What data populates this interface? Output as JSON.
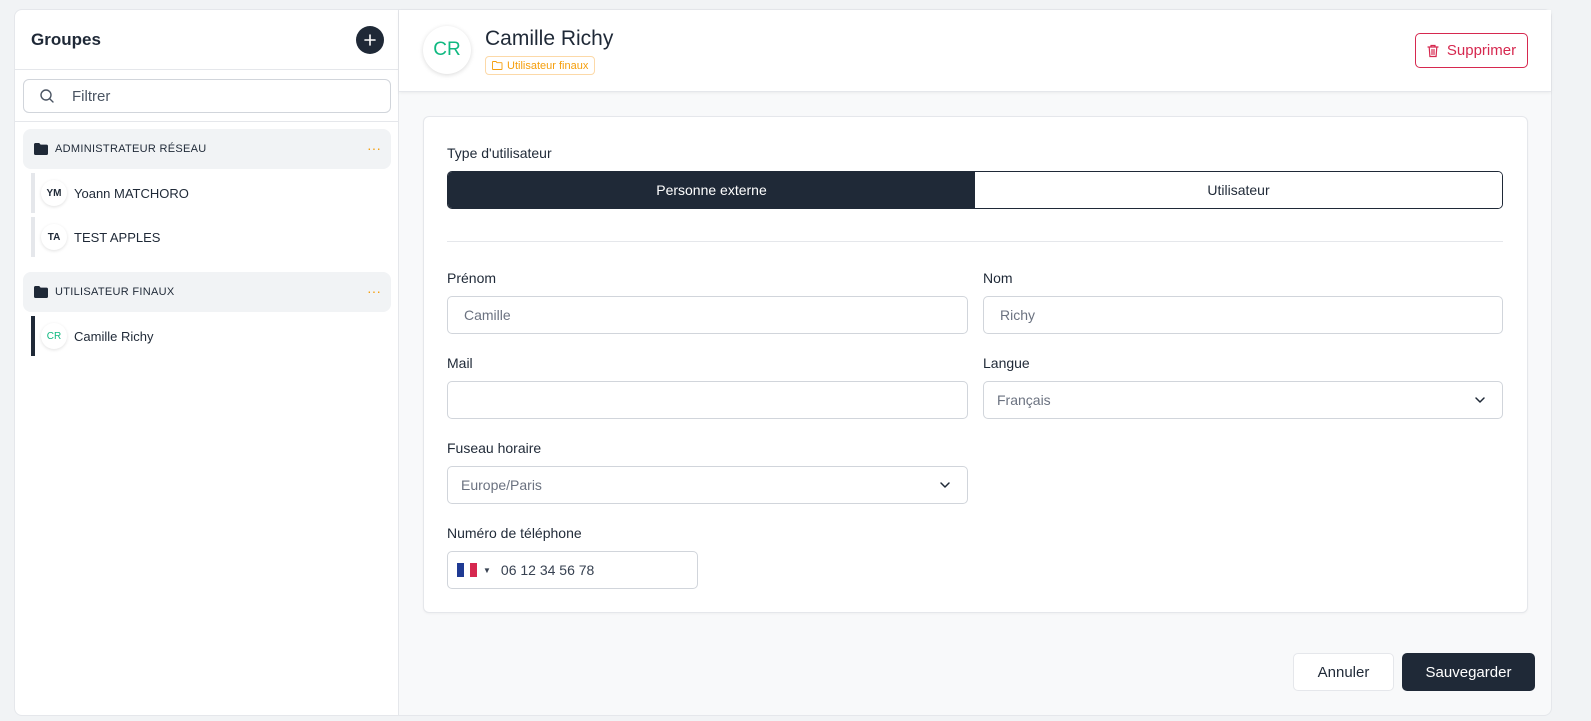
{
  "sidebar": {
    "title": "Groupes",
    "filter_placeholder": "Filtrer",
    "groups": [
      {
        "name": "ADMINISTRATEUR RÉSEAU",
        "menu": "···",
        "members": [
          {
            "initials": "YM",
            "name": "Yoann MATCHORO"
          },
          {
            "initials": "TA",
            "name": "TEST APPLES"
          }
        ]
      },
      {
        "name": "UTILISATEUR FINAUX",
        "menu": "···",
        "members": [
          {
            "initials": "CR",
            "name": "Camille Richy"
          }
        ]
      }
    ]
  },
  "header": {
    "avatar_initials": "CR",
    "user_name": "Camille Richy",
    "group_badge": "Utilisateur finaux",
    "delete_label": "Supprimer"
  },
  "form": {
    "user_type_label": "Type d'utilisateur",
    "user_type_options": [
      "Personne externe",
      "Utilisateur"
    ],
    "user_type_selected": "Personne externe",
    "first_name_label": "Prénom",
    "first_name_placeholder": "Camille",
    "last_name_label": "Nom",
    "last_name_placeholder": "Richy",
    "mail_label": "Mail",
    "mail_value": "",
    "language_label": "Langue",
    "language_value": "Français",
    "timezone_label": "Fuseau horaire",
    "timezone_value": "Europe/Paris",
    "phone_label": "Numéro de téléphone",
    "phone_value": "06 12 34 56 78"
  },
  "footer": {
    "cancel_label": "Annuler",
    "save_label": "Sauvegarder"
  },
  "colors": {
    "dark": "#1f2937",
    "accent_green": "#10b981",
    "accent_orange": "#f59e0b",
    "danger": "#d6284f"
  }
}
